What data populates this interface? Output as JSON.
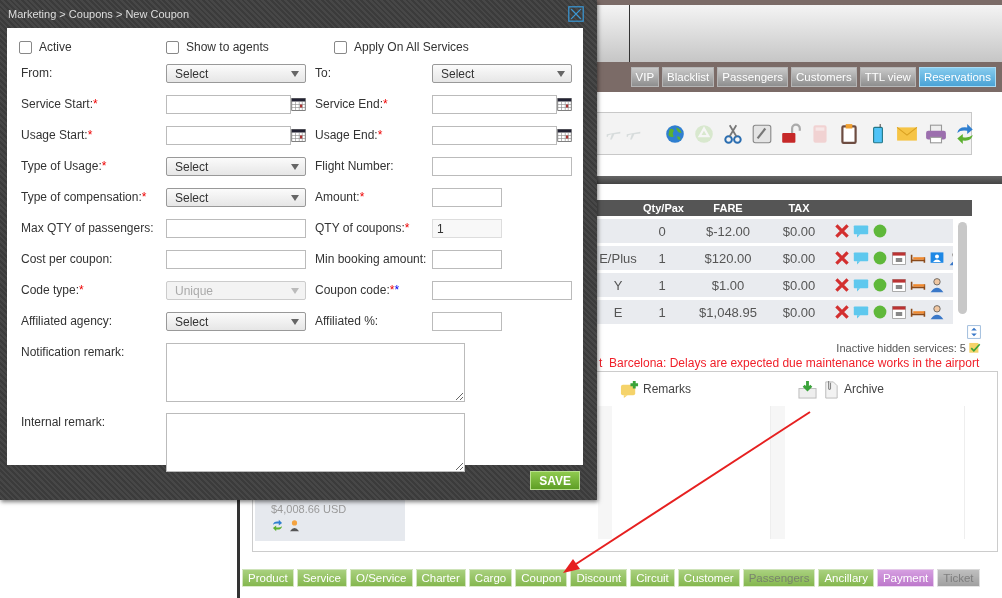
{
  "dialog": {
    "breadcrumb": "Marketing > Coupons > New Coupon",
    "checkboxes": [
      {
        "label": "Active",
        "checked": false
      },
      {
        "label": "Show to agents",
        "checked": false
      },
      {
        "label": "Apply On All Services",
        "checked": false
      }
    ],
    "fields": [
      {
        "label": "From:",
        "kind": "select",
        "value": "Select",
        "disabled": false
      },
      {
        "label": "To:",
        "kind": "select",
        "value": "Select",
        "disabled": false
      },
      {
        "label": "Service Start:",
        "required_mark": "*",
        "kind": "date",
        "disabled": false
      },
      {
        "label": "Service End:",
        "required_mark": "*",
        "kind": "date",
        "disabled": false
      },
      {
        "label": "Usage Start:",
        "required_mark": "*",
        "kind": "date",
        "disabled": false
      },
      {
        "label": "Usage End:",
        "required_mark": "*",
        "kind": "date",
        "disabled": false
      },
      {
        "label": "Type of Usage:",
        "required_mark": "*",
        "kind": "select",
        "value": "Select",
        "disabled": false
      },
      {
        "label": "Flight Number:",
        "kind": "text",
        "disabled": false
      },
      {
        "label": "Type of compensation:",
        "required_mark": "*",
        "kind": "select",
        "value": "Select",
        "disabled": false
      },
      {
        "label": "Amount:",
        "required_mark": "*",
        "kind": "short",
        "disabled": false
      },
      {
        "label": "Max QTY of passengers:",
        "kind": "text",
        "disabled": false
      },
      {
        "label": "QTY of coupons:",
        "required_mark": "*",
        "kind": "short",
        "value": "1",
        "disabled": false
      },
      {
        "label": "Cost per coupon:",
        "kind": "text",
        "disabled": false
      },
      {
        "label": "Min booking amount:",
        "kind": "short",
        "disabled": false
      },
      {
        "label": "Code type:",
        "required_mark": "*",
        "kind": "select",
        "value": "Unique",
        "disabled": true
      },
      {
        "label": "Coupon code:",
        "required_mark": "*",
        "extra_mark": "*",
        "kind": "text",
        "disabled": false
      },
      {
        "label": "Affiliated agency:",
        "kind": "select",
        "value": "Select",
        "disabled": false
      },
      {
        "label": "Affiliated %:",
        "kind": "short",
        "disabled": false
      },
      {
        "label": "Notification remark:",
        "kind": "textarea",
        "disabled": false
      },
      {
        "label": "Internal remark:",
        "kind": "textarea",
        "disabled": false
      }
    ],
    "save_button": "SAVE"
  },
  "nav_buttons": [
    {
      "label": "VIP",
      "selected": false
    },
    {
      "label": "Blacklist",
      "selected": false
    },
    {
      "label": "Passengers",
      "selected": false
    },
    {
      "label": "Customers",
      "selected": false
    },
    {
      "label": "TTL view",
      "selected": false
    },
    {
      "label": "Reservations",
      "selected": true
    }
  ],
  "toolbar_groups": [
    [
      {
        "kind": "plane",
        "disabled": true
      },
      {
        "kind": "plane",
        "disabled": true
      }
    ],
    [
      {
        "kind": "globe",
        "disabled": false
      },
      {
        "kind": "recycle",
        "disabled": true
      },
      {
        "kind": "scissors",
        "disabled": false
      },
      {
        "kind": "edit",
        "disabled": false
      },
      {
        "kind": "lock",
        "disabled": false
      },
      {
        "kind": "calculator",
        "disabled": true
      },
      {
        "kind": "clipboard",
        "disabled": false
      },
      {
        "kind": "phone",
        "disabled": false
      },
      {
        "kind": "mail",
        "disabled": false
      },
      {
        "kind": "printer",
        "disabled": false
      },
      {
        "kind": "sync",
        "disabled": false
      }
    ]
  ],
  "table": {
    "columns": [
      "Qty/Pax",
      "FARE",
      "TAX"
    ],
    "rows": [
      {
        "qty_pax": "0",
        "fare": "$-12.00",
        "tax": "$0.00",
        "icons": [
          {
            "kind": "delete"
          },
          {
            "kind": "comment"
          },
          {
            "kind": "status"
          }
        ]
      },
      {
        "column_1": "E/Plus",
        "qty_pax": "1",
        "fare": "$120.00",
        "tax": "$0.00",
        "icons": [
          {
            "kind": "delete"
          },
          {
            "kind": "comment"
          },
          {
            "kind": "status"
          },
          {
            "kind": "calendar"
          },
          {
            "kind": "bed"
          },
          {
            "kind": "screen"
          },
          {
            "kind": "person"
          }
        ]
      },
      {
        "column_1": "Y",
        "qty_pax": "1",
        "fare": "$1.00",
        "tax": "$0.00",
        "icons": [
          {
            "kind": "delete"
          },
          {
            "kind": "comment"
          },
          {
            "kind": "status"
          },
          {
            "kind": "calendar"
          },
          {
            "kind": "bed"
          },
          {
            "kind": "person"
          }
        ]
      },
      {
        "column_1": "E",
        "qty_pax": "1",
        "fare": "$1,048.95",
        "tax": "$0.00",
        "icons": [
          {
            "kind": "delete"
          },
          {
            "kind": "comment"
          },
          {
            "kind": "status"
          },
          {
            "kind": "calendar"
          },
          {
            "kind": "bed"
          },
          {
            "kind": "person"
          }
        ]
      }
    ]
  },
  "hidden_services": "Inactive hidden services: 5",
  "notice": "t  Barcelona: Delays are expected due maintenance works in the airport",
  "panel": {
    "remarks": "Remarks",
    "archive": "Archive",
    "total": "$4,008.66 USD"
  },
  "bottom_tabs": [
    {
      "label": "Product",
      "color": "#8cc153",
      "disabled": false
    },
    {
      "label": "Service",
      "color": "#8cc153",
      "disabled": false
    },
    {
      "label": "O/Service",
      "color": "#8cc153",
      "disabled": false
    },
    {
      "label": "Charter",
      "color": "#8cc153",
      "disabled": false
    },
    {
      "label": "Cargo",
      "color": "#8cc153",
      "disabled": false
    },
    {
      "label": "Coupon",
      "color": "#8cc153",
      "disabled": false
    },
    {
      "label": "Discount",
      "color": "#8cc153",
      "disabled": false
    },
    {
      "label": "Circuit",
      "color": "#8cc153",
      "disabled": false
    },
    {
      "label": "Customer",
      "color": "#8cc153",
      "disabled": false
    },
    {
      "label": "Passengers",
      "color": "#8cc153",
      "disabled": true
    },
    {
      "label": "Ancillary",
      "color": "#8cc153",
      "disabled": false
    },
    {
      "label": "Payment",
      "color": "#c77ed6",
      "disabled": false
    },
    {
      "label": "Ticket",
      "color": "#a9a9a9",
      "disabled": true
    }
  ]
}
